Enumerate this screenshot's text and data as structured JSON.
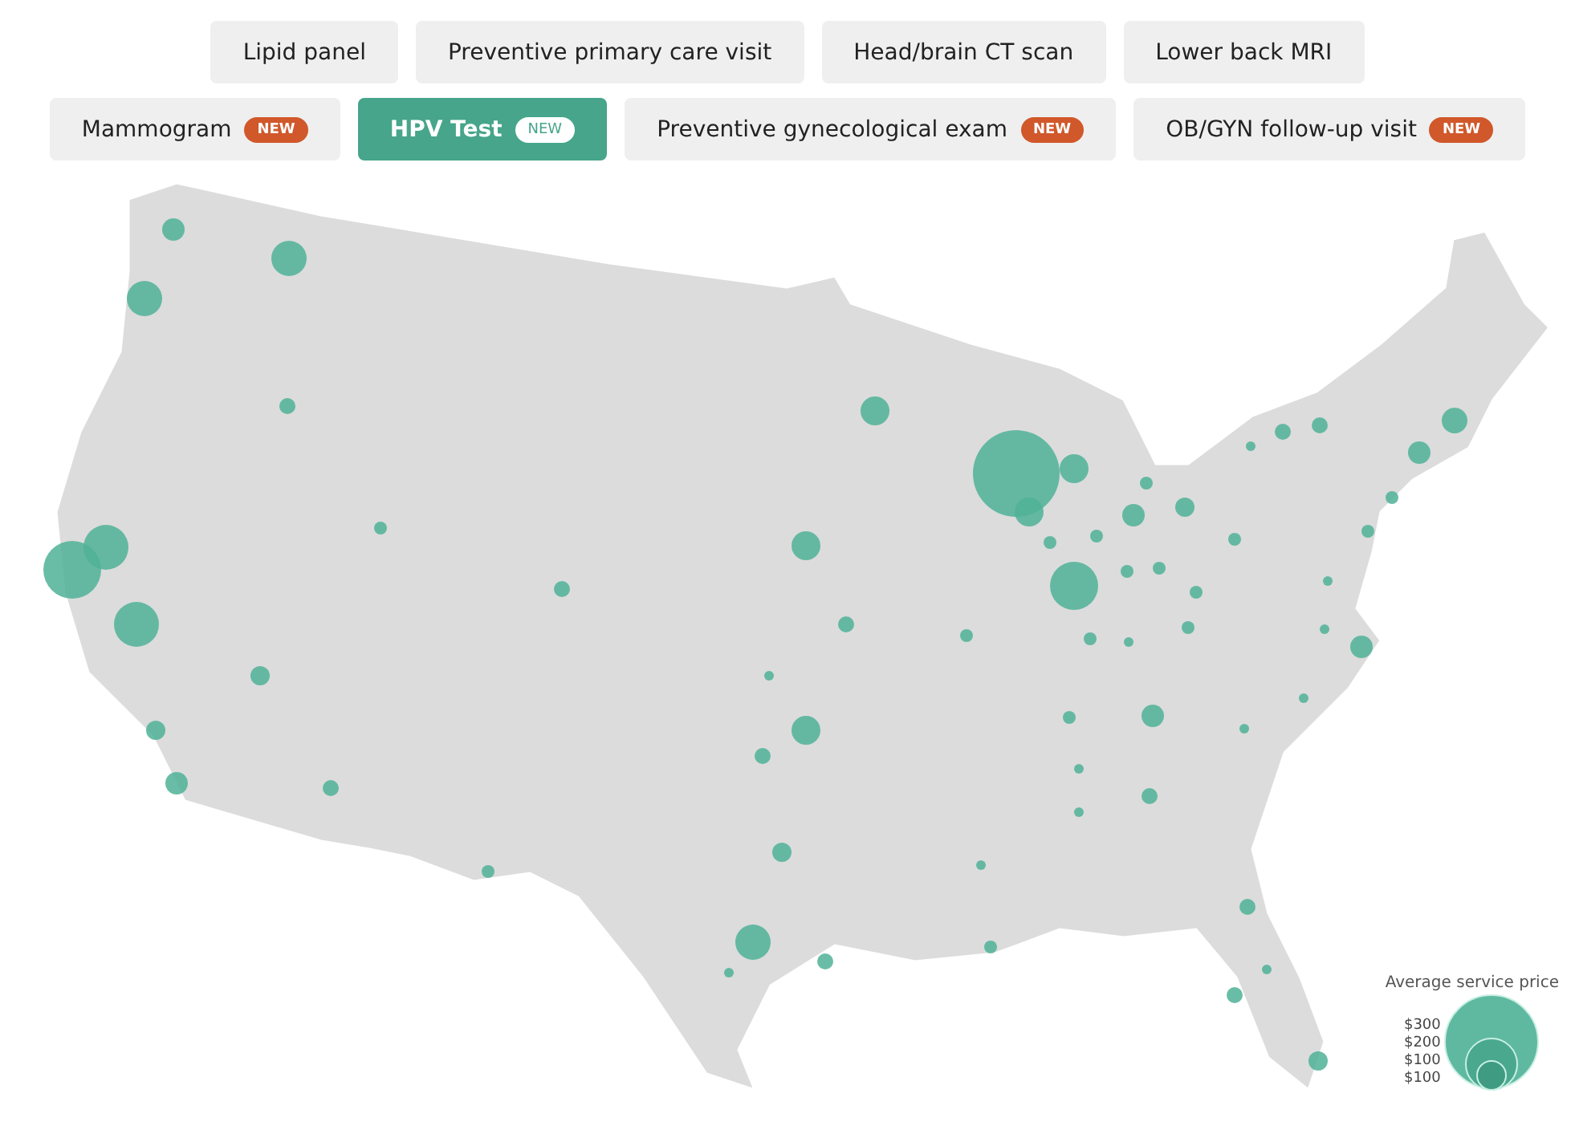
{
  "filter_rows": [
    [
      {
        "label": "Lipid panel",
        "selected": false
      },
      {
        "label": "Preventive primary care visit",
        "selected": false
      },
      {
        "label": "Head/brain CT scan",
        "selected": false
      },
      {
        "label": "Lower back MRI",
        "selected": false
      }
    ],
    [
      {
        "label": "Mammogram",
        "selected": false,
        "badge": "NEW"
      },
      {
        "label": "HPV Test",
        "selected": true,
        "badge": "NEW"
      },
      {
        "label": "Preventive gynecological exam",
        "selected": false,
        "badge": "NEW"
      },
      {
        "label": "OB/GYN follow-up visit",
        "selected": false,
        "badge": "NEW"
      }
    ]
  ],
  "legend": {
    "title": "Average service price",
    "labels": [
      "$300",
      "$200",
      "$100",
      "$100"
    ]
  }
}
